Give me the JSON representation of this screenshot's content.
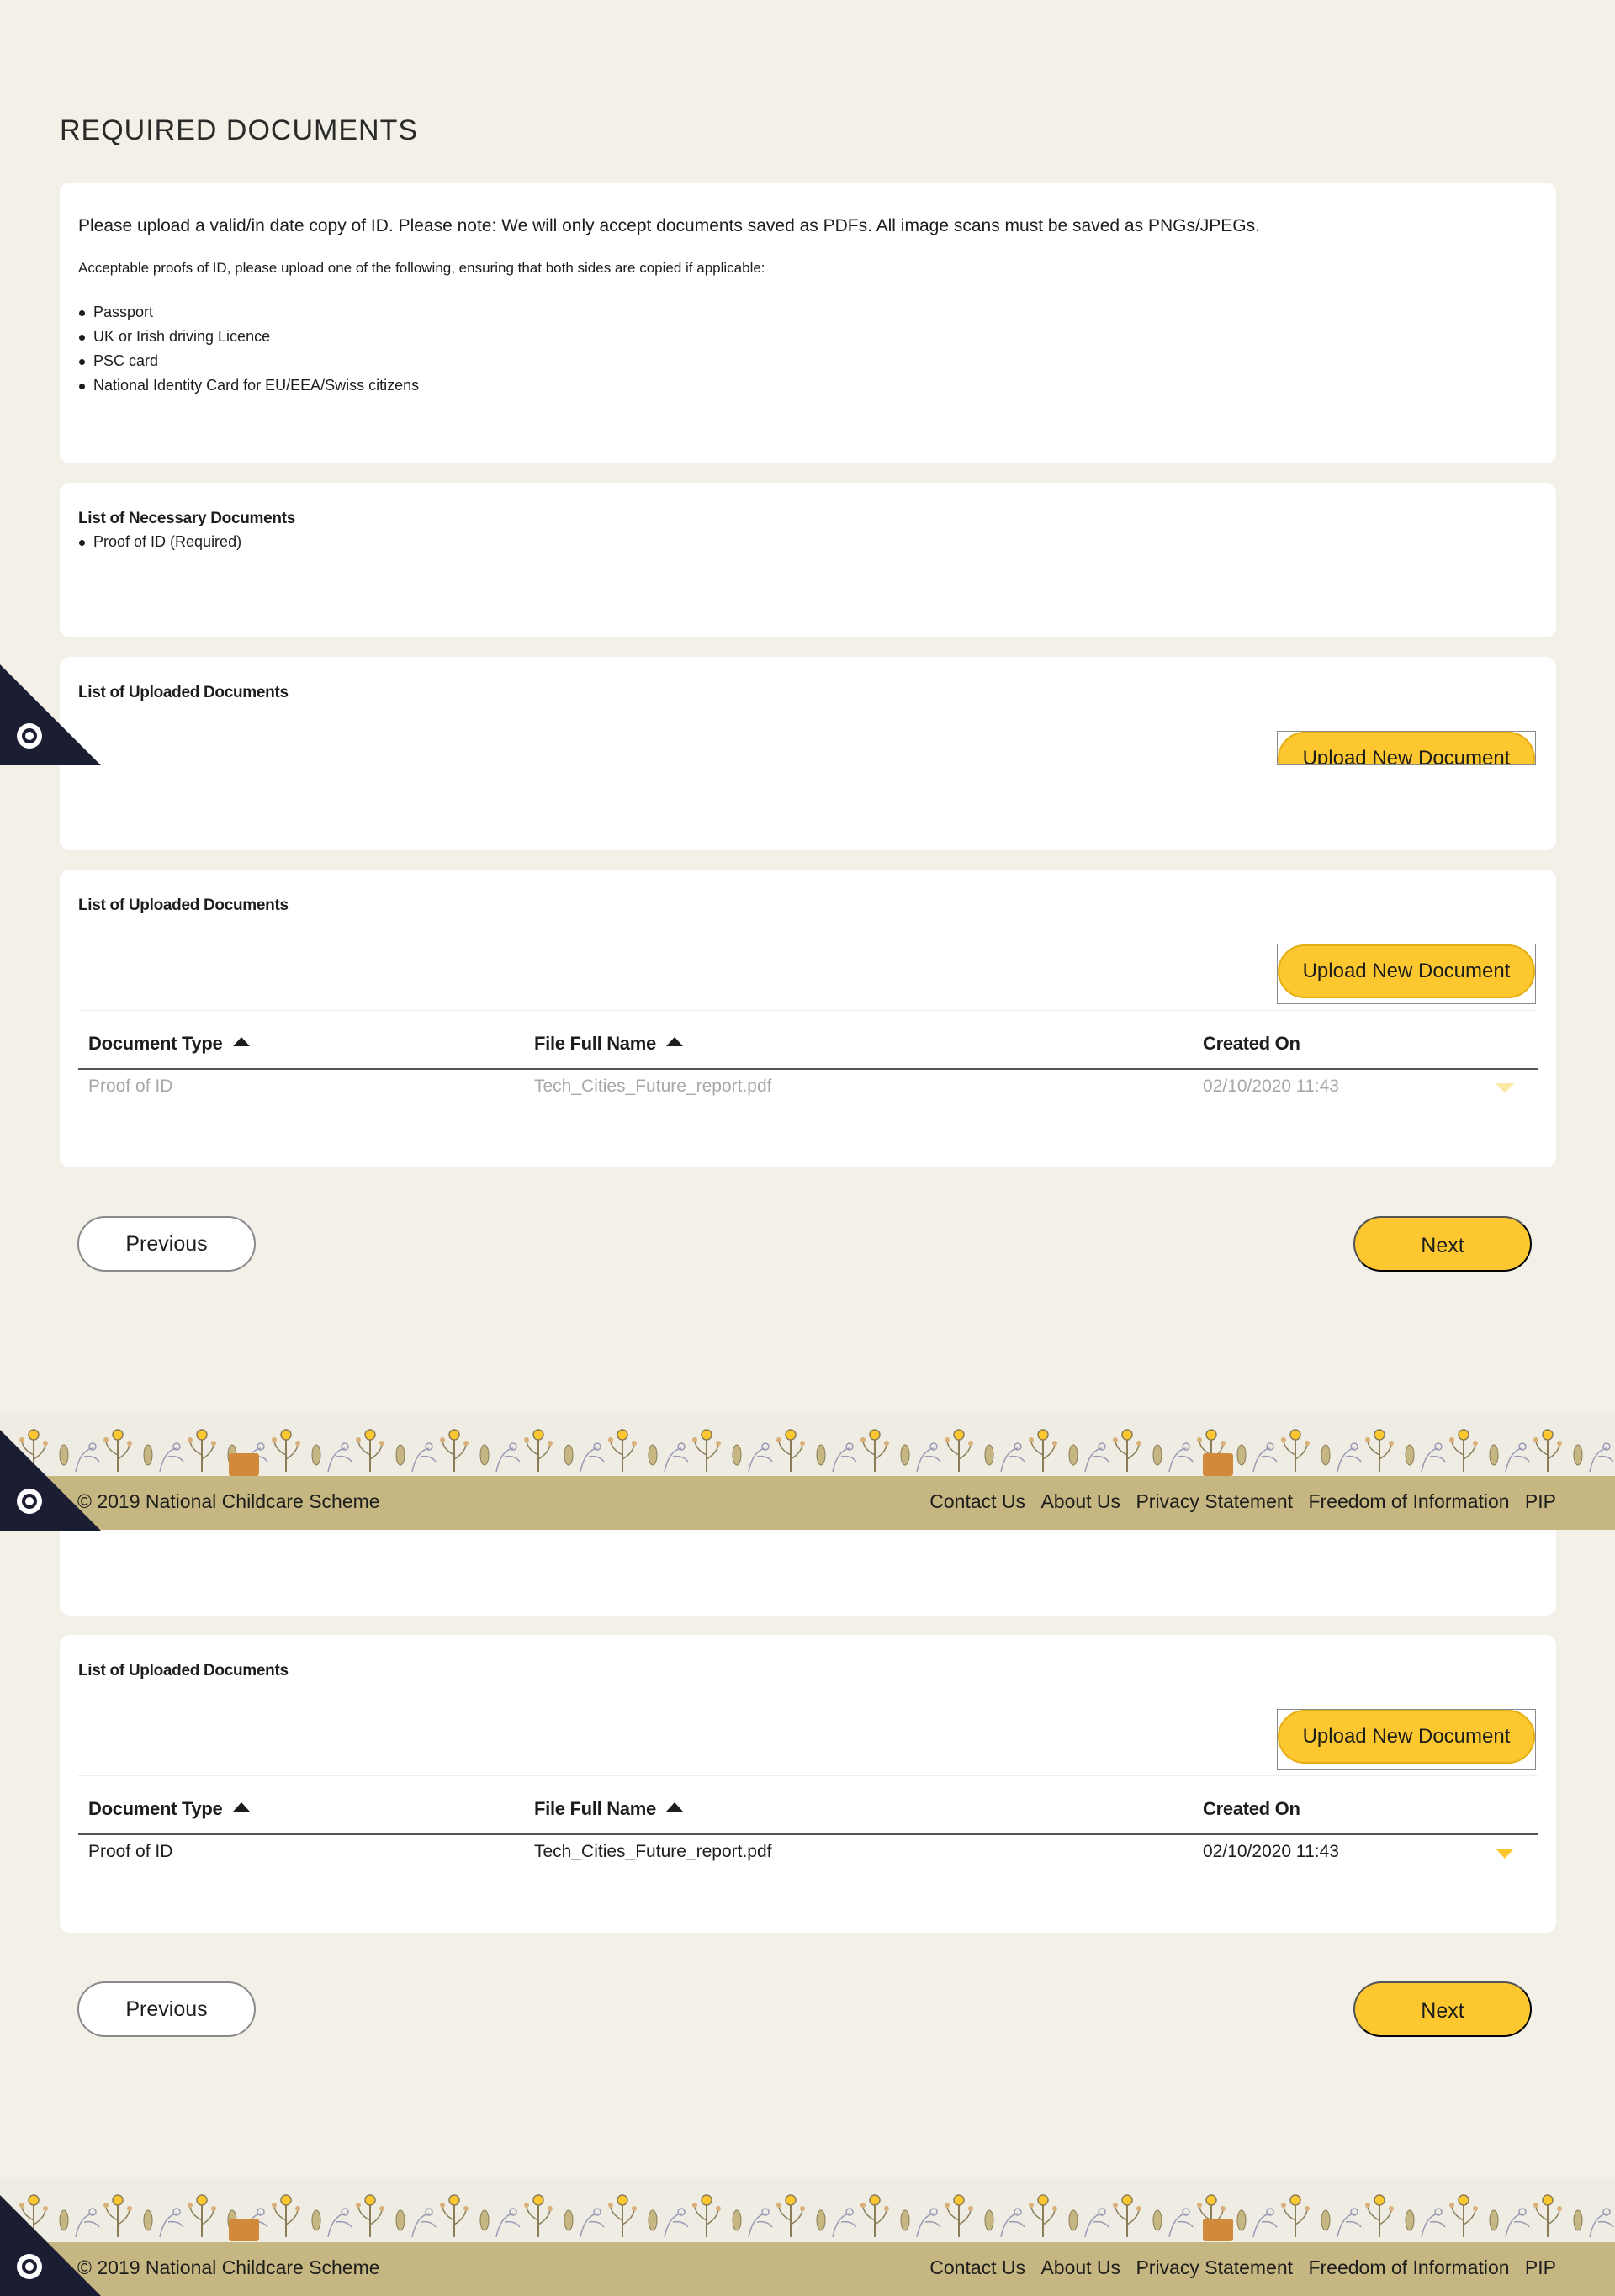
{
  "page": {
    "title": "REQUIRED DOCUMENTS"
  },
  "intro": {
    "text": "Please upload a valid/in date copy of ID. Please note: We will only accept documents saved as PDFs. All image scans must be saved as PNGs/JPEGs.",
    "proof_text": "Acceptable proofs of ID, please upload one of the following, ensuring that both sides are copied if applicable:",
    "items": [
      "Passport",
      "UK or Irish driving Licence",
      "PSC card",
      "National Identity Card for EU/EEA/Swiss citizens"
    ]
  },
  "necessary": {
    "title": "List of Necessary Documents",
    "items": [
      "Proof of ID (Required)"
    ]
  },
  "uploaded": {
    "title": "List of Uploaded Documents",
    "upload_label": "Upload New Document",
    "columns": [
      "Document Type",
      "File Full Name",
      "Created On"
    ],
    "rows": [
      {
        "type": "Proof of ID",
        "file": "Tech_Cities_Future_report.pdf",
        "created": "02/10/2020 11:43"
      }
    ]
  },
  "nav": {
    "previous_label": "Previous",
    "next_label": "Next"
  },
  "footer": {
    "copyright": "© 2019 National Childcare Scheme",
    "links": [
      "Contact Us",
      "About Us",
      "Privacy Statement",
      "Freedom of Information",
      "PIP"
    ]
  },
  "colors": {
    "accent": "#fdc82f",
    "footer_bar": "#c5b682",
    "background": "#f3f0e8",
    "cookie_tab": "#1b1d33"
  },
  "icons": {
    "cookie": "cookie-settings-icon",
    "sort": "sort-ascending-icon",
    "row_menu": "chevron-down-icon"
  }
}
